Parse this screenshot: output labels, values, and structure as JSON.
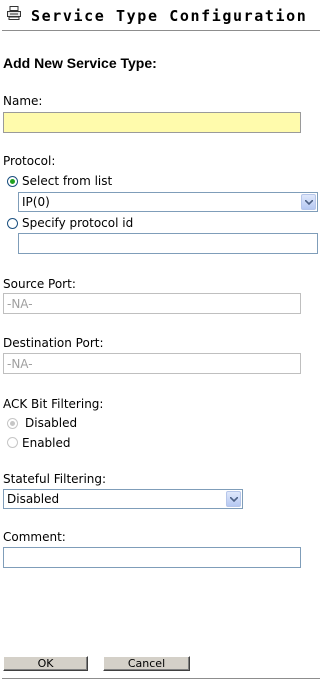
{
  "header": {
    "title": "Service Type Configuration",
    "icon": "service-config-icon"
  },
  "form": {
    "heading": "Add New Service Type:",
    "name_label": "Name:",
    "name_value": "",
    "protocol_label": "Protocol:",
    "select_from_list_label": "Select from list",
    "protocol_selected": "IP(0)",
    "specify_protocol_id_label": "Specify protocol id",
    "protocol_id_value": "",
    "source_port_label": "Source Port:",
    "source_port_value": "-NA-",
    "destination_port_label": "Destination Port:",
    "destination_port_value": "-NA-",
    "ack_label": "ACK Bit Filtering:",
    "ack_disabled_label": "Disabled",
    "ack_enabled_label": "Enabled",
    "stateful_label": "Stateful Filtering:",
    "stateful_selected": "Disabled",
    "comment_label": "Comment:",
    "comment_value": ""
  },
  "buttons": {
    "ok": "OK",
    "cancel": "Cancel"
  }
}
